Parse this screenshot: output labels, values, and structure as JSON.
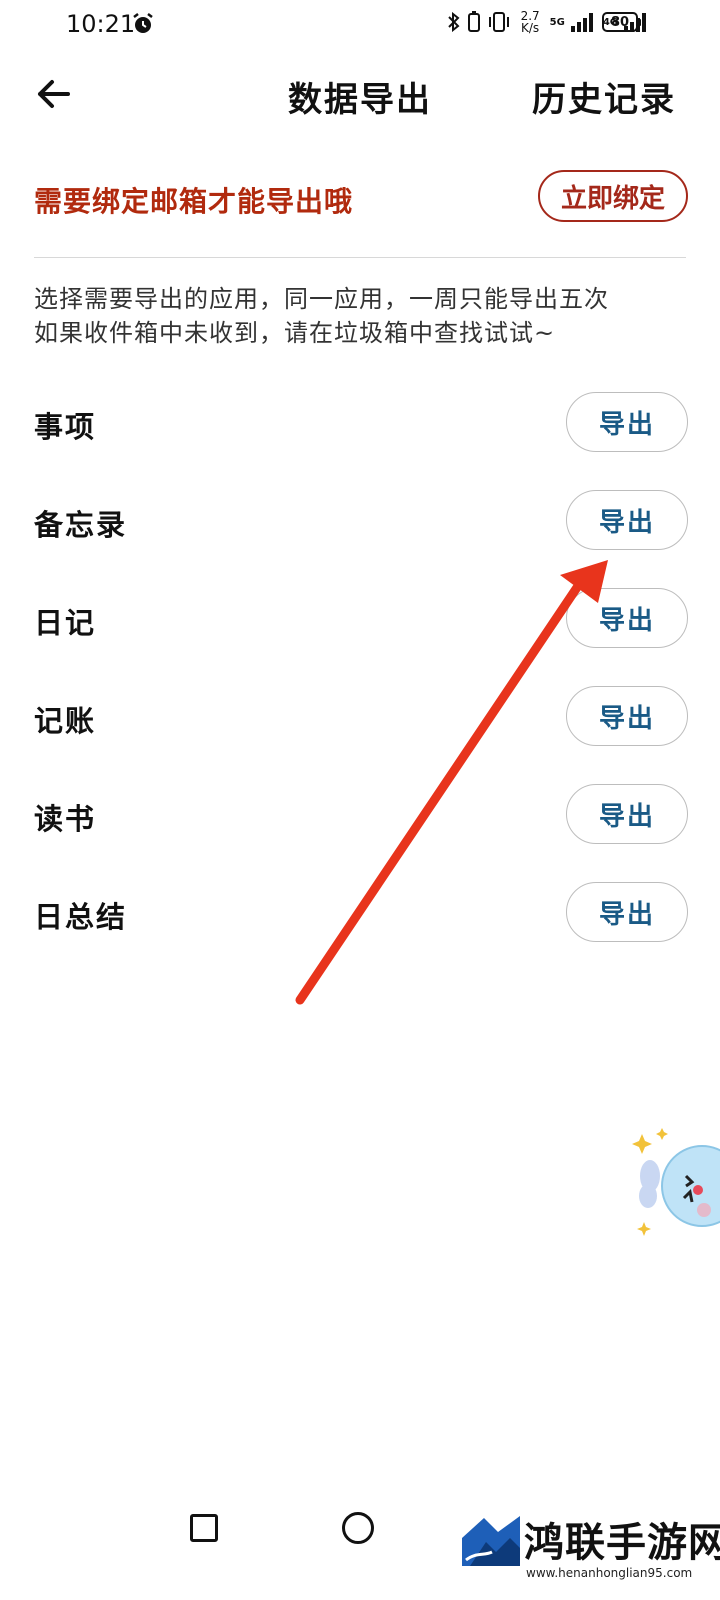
{
  "status_bar": {
    "time": "10:21",
    "speed_value": "2.7",
    "speed_unit": "K/s",
    "net1": "5G",
    "net2": "4G",
    "battery": "80"
  },
  "header": {
    "title": "数据导出",
    "history_label": "历史记录"
  },
  "bind_banner": {
    "message": "需要绑定邮箱才能导出哦",
    "button_label": "立即绑定"
  },
  "hint": {
    "line1": "选择需要导出的应用，同一应用，一周只能导出五次",
    "line2": "如果收件箱中未收到，请在垃圾箱中查找试试~"
  },
  "apps": [
    {
      "name": "事项",
      "button": "导出"
    },
    {
      "name": "备忘录",
      "button": "导出"
    },
    {
      "name": "日记",
      "button": "导出"
    },
    {
      "name": "记账",
      "button": "导出"
    },
    {
      "name": "读书",
      "button": "导出"
    },
    {
      "name": "日总结",
      "button": "导出"
    }
  ],
  "watermark": {
    "title": "鸿联手游网",
    "url": "www.henanhonglian95.com"
  },
  "colors": {
    "accent_red": "#b12a0e",
    "export_text": "#1a5a86",
    "arrow": "#e8341c"
  }
}
